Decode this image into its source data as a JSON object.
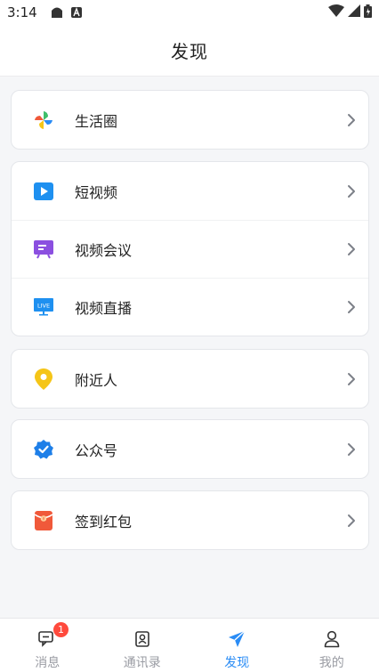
{
  "status_bar": {
    "time": "3:14"
  },
  "header": {
    "title": "发现"
  },
  "groups": [
    {
      "items": [
        {
          "label": "生活圈",
          "icon": "pinwheel-icon"
        }
      ]
    },
    {
      "items": [
        {
          "label": "短视频",
          "icon": "play-video-icon"
        },
        {
          "label": "视频会议",
          "icon": "meeting-screen-icon"
        },
        {
          "label": "视频直播",
          "icon": "live-tv-icon"
        }
      ]
    },
    {
      "items": [
        {
          "label": "附近人",
          "icon": "location-pin-icon"
        }
      ]
    },
    {
      "items": [
        {
          "label": "公众号",
          "icon": "verified-badge-icon"
        }
      ]
    },
    {
      "items": [
        {
          "label": "签到红包",
          "icon": "red-envelope-icon"
        }
      ]
    }
  ],
  "tabbar": {
    "tabs": [
      {
        "label": "消息",
        "badge": "1"
      },
      {
        "label": "通讯录"
      },
      {
        "label": "发现"
      },
      {
        "label": "我的"
      }
    ],
    "active_color": "#2a8cf5",
    "inactive_color": "#9a9ca3"
  },
  "colors": {
    "accent": "#2a8cf5",
    "badge": "#ff4a3d",
    "meeting": "#8b4fe0",
    "location": "#f5c518",
    "envelope": "#f0593a"
  }
}
